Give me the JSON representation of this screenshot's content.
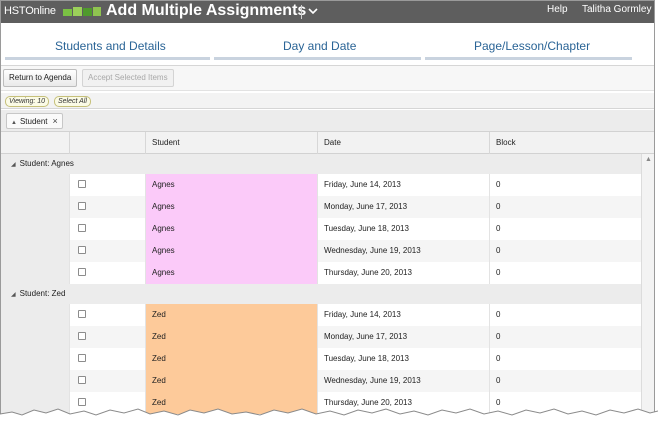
{
  "header": {
    "logo_text": "HSTOnline",
    "title": "Add Multiple Assignments",
    "help_label": "Help",
    "user_name": "Talitha Gormley"
  },
  "steps": [
    {
      "label": "Students and Details"
    },
    {
      "label": "Day and Date"
    },
    {
      "label": "Page/Lesson/Chapter"
    }
  ],
  "toolbar": {
    "return_label": "Return to Agenda",
    "accept_label": "Accept Selected Items"
  },
  "filters": {
    "viewing_label": "Viewing: 10",
    "select_all_label": "Select All"
  },
  "groupby": {
    "chip_label": "Student",
    "remove_glyph": "×"
  },
  "columns": {
    "student": "Student",
    "date": "Date",
    "block": "Block"
  },
  "groups": [
    {
      "label": "Student: Agnes",
      "color": "#fbcaf9",
      "rows": [
        {
          "student": "Agnes",
          "date": "Friday, June 14, 2013",
          "block": "0"
        },
        {
          "student": "Agnes",
          "date": "Monday, June 17, 2013",
          "block": "0"
        },
        {
          "student": "Agnes",
          "date": "Tuesday, June 18, 2013",
          "block": "0"
        },
        {
          "student": "Agnes",
          "date": "Wednesday, June 19, 2013",
          "block": "0"
        },
        {
          "student": "Agnes",
          "date": "Thursday, June 20, 2013",
          "block": "0"
        }
      ]
    },
    {
      "label": "Student: Zed",
      "color": "#fdca9a",
      "rows": [
        {
          "student": "Zed",
          "date": "Friday, June 14, 2013",
          "block": "0"
        },
        {
          "student": "Zed",
          "date": "Monday, June 17, 2013",
          "block": "0"
        },
        {
          "student": "Zed",
          "date": "Tuesday, June 18, 2013",
          "block": "0"
        },
        {
          "student": "Zed",
          "date": "Wednesday, June 19, 2013",
          "block": "0"
        },
        {
          "student": "Zed",
          "date": "Thursday, June 20, 2013",
          "block": "0"
        }
      ]
    }
  ],
  "colors": {
    "topbar": "#5e5e5e",
    "step_text": "#2a6496",
    "logo_green": "#7ac143"
  }
}
